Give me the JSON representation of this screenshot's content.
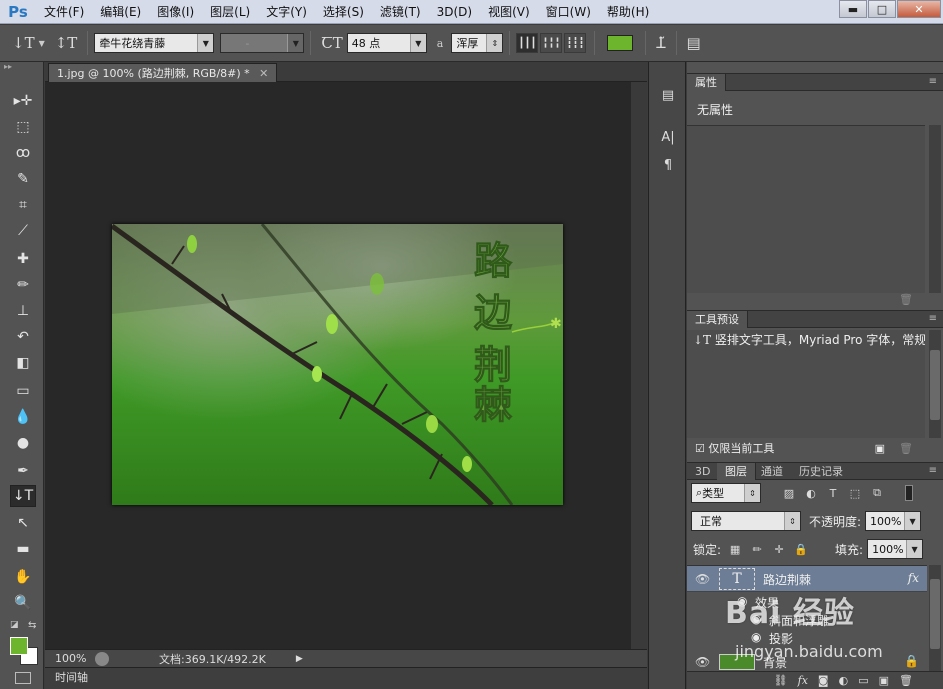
{
  "app": {
    "logo": "Ps"
  },
  "menu": [
    "文件(F)",
    "编辑(E)",
    "图像(I)",
    "图层(L)",
    "文字(Y)",
    "选择(S)",
    "滤镜(T)",
    "3D(D)",
    "视图(V)",
    "窗口(W)",
    "帮助(H)"
  ],
  "window_controls": {
    "minimize": "▬",
    "maximize": "□",
    "close": "✕"
  },
  "options": {
    "font_family": "牵牛花绕青藤",
    "font_style": "-",
    "font_size": "48 点",
    "antialias_icon": "a",
    "antialias": "浑厚",
    "text_color": "#6cb52d"
  },
  "document": {
    "tab_title": "1.jpg @ 100% (路边荆棘, RGB/8#) *",
    "image_text": [
      "路",
      "边",
      "荆",
      "棘"
    ],
    "zoom": "100%",
    "doc_info": "文档:369.1K/492.2K",
    "timeline": "时间轴"
  },
  "panels": {
    "properties": {
      "tab": "属性",
      "body": "无属性"
    },
    "tool_presets": {
      "tab": "工具预设",
      "item": "竖排文字工具，Myriad Pro 字体，常规",
      "current_only": "仅限当前工具"
    },
    "layers": {
      "tabs": [
        "3D",
        "图层",
        "通道",
        "历史记录"
      ],
      "filter_type": "类型",
      "blend_mode": "正常",
      "opacity_label": "不透明度:",
      "opacity_value": "100%",
      "lock_label": "锁定:",
      "fill_label": "填充:",
      "fill_value": "100%",
      "text_layer_name": "路边荆棘",
      "effects_label": "效果",
      "effect_1": "斜面和浮雕",
      "effect_2": "投影",
      "bg_layer_name": "背景"
    }
  },
  "watermark": {
    "main": "Bai 经验",
    "url": "jingyan.baidu.com"
  }
}
